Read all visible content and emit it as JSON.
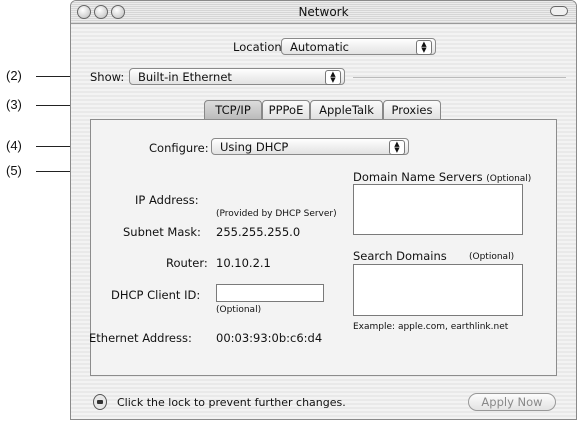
{
  "callouts": [
    "(2)",
    "(3)",
    "(4)",
    "(5)"
  ],
  "window": {
    "title": "Network"
  },
  "location": {
    "label": "Location:",
    "value": "Automatic"
  },
  "show": {
    "label": "Show:",
    "value": "Built-in Ethernet"
  },
  "tabs": [
    "TCP/IP",
    "PPPoE",
    "AppleTalk",
    "Proxies"
  ],
  "configure": {
    "label": "Configure:",
    "value": "Using DHCP"
  },
  "fields": {
    "ip_label": "IP Address:",
    "ip_note": "(Provided by DHCP Server)",
    "subnet_label": "Subnet Mask:",
    "subnet_value": "255.255.255.0",
    "router_label": "Router:",
    "router_value": "10.10.2.1",
    "dhcp_label": "DHCP Client ID:",
    "dhcp_value": "",
    "dhcp_note": "(Optional)",
    "ethernet_label": "Ethernet Address:",
    "ethernet_value": "00:03:93:0b:c6:d4"
  },
  "dns": {
    "label": "Domain Name Servers",
    "optional": "(Optional)"
  },
  "search_domains": {
    "label": "Search Domains",
    "optional": "(Optional)",
    "example": "Example: apple.com, earthlink.net"
  },
  "footer": {
    "lock_text": "Click the lock to prevent further changes.",
    "apply_label": "Apply Now"
  }
}
